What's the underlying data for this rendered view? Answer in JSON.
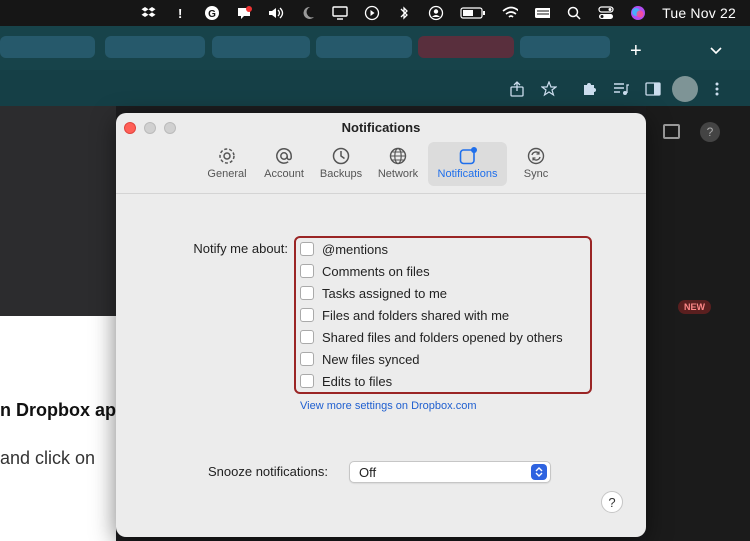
{
  "menubar": {
    "date": "Tue Nov 22",
    "icons": [
      "dropbox-icon",
      "app-icon",
      "grammarly-icon",
      "chat-icon",
      "volume-icon",
      "moon-icon",
      "display-icon",
      "play-icon",
      "bluetooth-icon",
      "user-icon",
      "battery-icon",
      "wifi-icon",
      "keyboard-icon",
      "search-icon",
      "control-center-icon",
      "siri-icon"
    ]
  },
  "dialog": {
    "title": "Notifications",
    "tabs": [
      {
        "label": "General",
        "icon": "gear-icon",
        "active": false
      },
      {
        "label": "Account",
        "icon": "at-icon",
        "active": false
      },
      {
        "label": "Backups",
        "icon": "clock-icon",
        "active": false
      },
      {
        "label": "Network",
        "icon": "globe-icon",
        "active": false
      },
      {
        "label": "Notifications",
        "icon": "notification-icon",
        "active": true
      },
      {
        "label": "Sync",
        "icon": "sync-icon",
        "active": false
      }
    ],
    "notify_label": "Notify me about:",
    "options": [
      {
        "label": "@mentions",
        "checked": false
      },
      {
        "label": "Comments on files",
        "checked": false
      },
      {
        "label": "Tasks assigned to me",
        "checked": false
      },
      {
        "label": "Files and folders shared with me",
        "checked": false
      },
      {
        "label": "Shared files and folders opened by others",
        "checked": false
      },
      {
        "label": "New files synced",
        "checked": false
      },
      {
        "label": "Edits to files",
        "checked": false
      }
    ],
    "more_link": "View more settings on Dropbox.com",
    "snooze_label": "Snooze notifications:",
    "snooze_value": "Off",
    "help": "?"
  },
  "page": {
    "text_1": "n Dropbox ap",
    "text_2": "and click on",
    "badge": "NEW"
  },
  "colors": {
    "accent": "#1f6feb",
    "highlight_box": "#9a2525",
    "link": "#2060d0",
    "browser_bg": "#153f46"
  }
}
